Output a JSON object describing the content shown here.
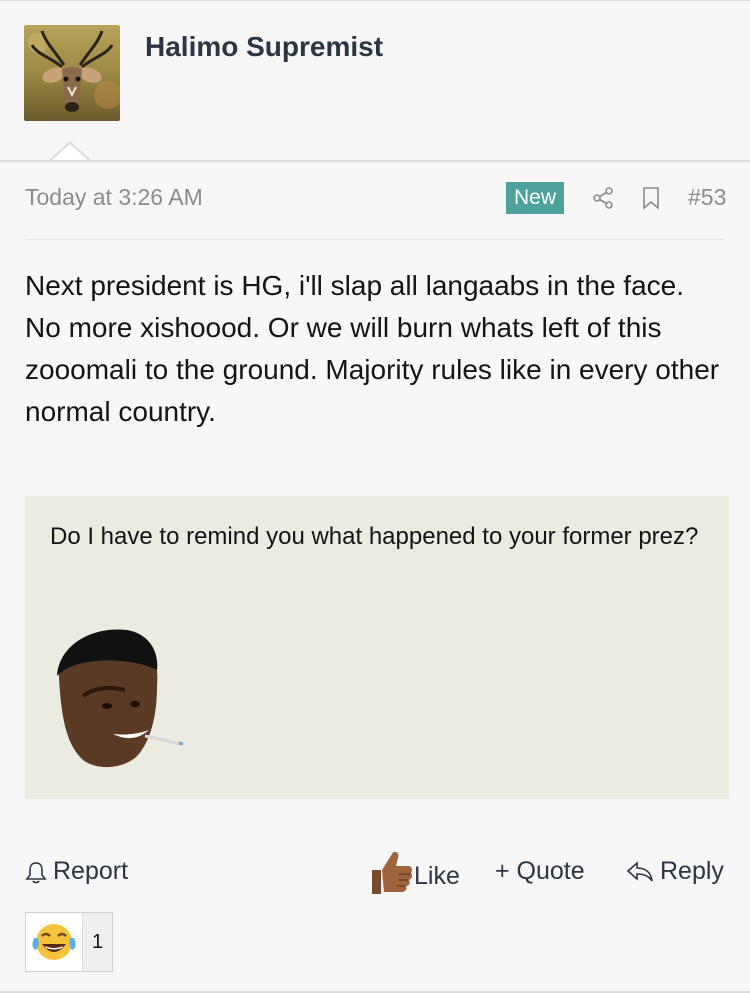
{
  "author": {
    "name": "Halimo Supremist",
    "avatar_icon": "kudu-antelope-avatar"
  },
  "post": {
    "timestamp": "Today at 3:26 AM",
    "badge": "New",
    "number": "#53",
    "body": "Next president is HG, i'll slap all langaabs in the face. No more xishoood. Or we will burn whats left of this zooomali to the ground. Majority rules like in every other normal country.",
    "quote": {
      "text": "Do I have to remind you what happened to your former prez?",
      "image_icon": "smiling-man-sticker"
    }
  },
  "actions": {
    "report": "Report",
    "like": "Like",
    "quote": "+ Quote",
    "reply": "Reply"
  },
  "reactions": [
    {
      "emoji": "😂",
      "icon": "laughing-tears-emoji",
      "count": "1"
    }
  ],
  "colors": {
    "accent": "#4ea29b",
    "text": "#141414",
    "muted": "#8c8c8c",
    "quote_bg": "#ebebe2"
  }
}
